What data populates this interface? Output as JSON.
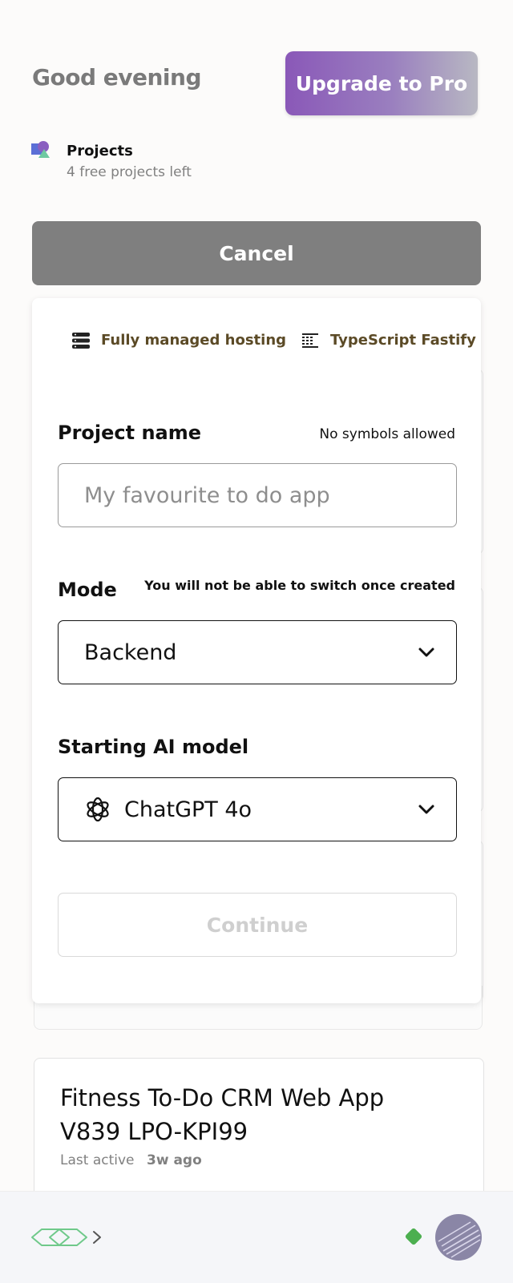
{
  "header": {
    "greeting": "Good evening",
    "upgrade_label": "Upgrade to Pro"
  },
  "projects": {
    "title": "Projects",
    "subtitle": "4 free projects left"
  },
  "cancel_label": "Cancel",
  "form": {
    "features": [
      {
        "icon": "server-icon",
        "label": "Fully managed hosting"
      },
      {
        "icon": "api-icon",
        "label": "TypeScript Fastify API"
      }
    ],
    "project_name": {
      "label": "Project name",
      "hint": "No symbols allowed",
      "placeholder": "My favourite to do app"
    },
    "mode": {
      "label": "Mode",
      "hint": "You will not be able to switch once created",
      "value": "Backend"
    },
    "model": {
      "label": "Starting AI model",
      "value": "ChatGPT 4o",
      "icon": "openai-icon"
    },
    "continue_label": "Continue"
  },
  "project_card": {
    "name": "Fitness To-Do CRM Web App V839 LPO-KPI99",
    "last_active_label": "Last active",
    "last_active_value": "3w ago"
  },
  "bottom_bar": {
    "status_color": "#4caf50"
  },
  "colors": {
    "accent_gradient_start": "#8a58b8",
    "feature_text": "#5b4a26",
    "cancel_bg": "#7f7f7f"
  }
}
